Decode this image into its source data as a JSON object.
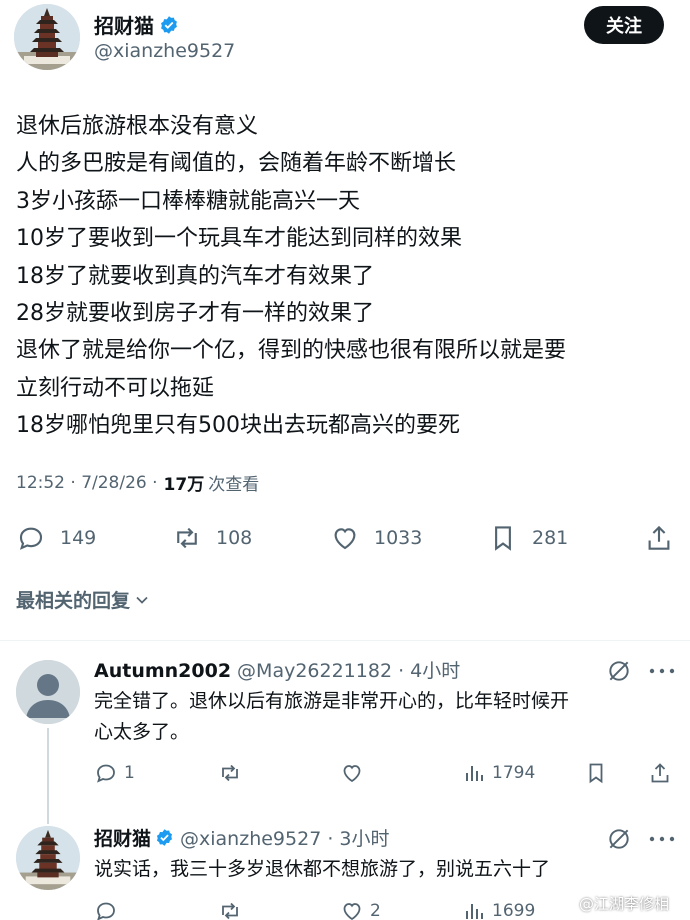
{
  "author": {
    "name": "招财猫",
    "handle": "@xianzhe9527",
    "follow_label": "关注",
    "verified_color": "#1d9bf0"
  },
  "tweet": {
    "lines": [
      "退休后旅游根本没有意义",
      "人的多巴胺是有阈值的，会随着年龄不断增长",
      "3岁小孩舔一口棒棒糖就能高兴一天",
      "10岁了要收到一个玩具车才能达到同样的效果",
      "18岁了就要收到真的汽车才有效果了",
      "28岁就要收到房子才有一样的效果了",
      "退休了就是给你一个亿，得到的快感也很有限所以就是要",
      "立刻行动不可以拖延",
      "18岁哪怕兜里只有500块出去玩都高兴的要死"
    ],
    "timestamp": "12:52 · 7/28/26 ·",
    "views_count": "17万",
    "views_label": "次查看",
    "stats": {
      "replies": "149",
      "retweets": "108",
      "likes": "1033",
      "bookmarks": "281"
    }
  },
  "sort_label": "最相关的回复",
  "replies": [
    {
      "name": "Autumn2002",
      "handle": "@May26221182 · 4小时",
      "text_lines": [
        "完全错了。退休以后有旅游是非常开心的，比年轻时候开",
        "心太多了。"
      ],
      "reply_count": "1",
      "retweet_count": "",
      "like_count": "",
      "view_count": "1794"
    },
    {
      "name": "招财猫",
      "handle": "@xianzhe9527 · 3小时",
      "text_lines": [
        "说实话，我三十多岁退休都不想旅游了，别说五六十了"
      ],
      "reply_count": "",
      "retweet_count": "",
      "like_count": "2",
      "view_count": "1699"
    }
  ],
  "watermark": "@江湖李修相"
}
